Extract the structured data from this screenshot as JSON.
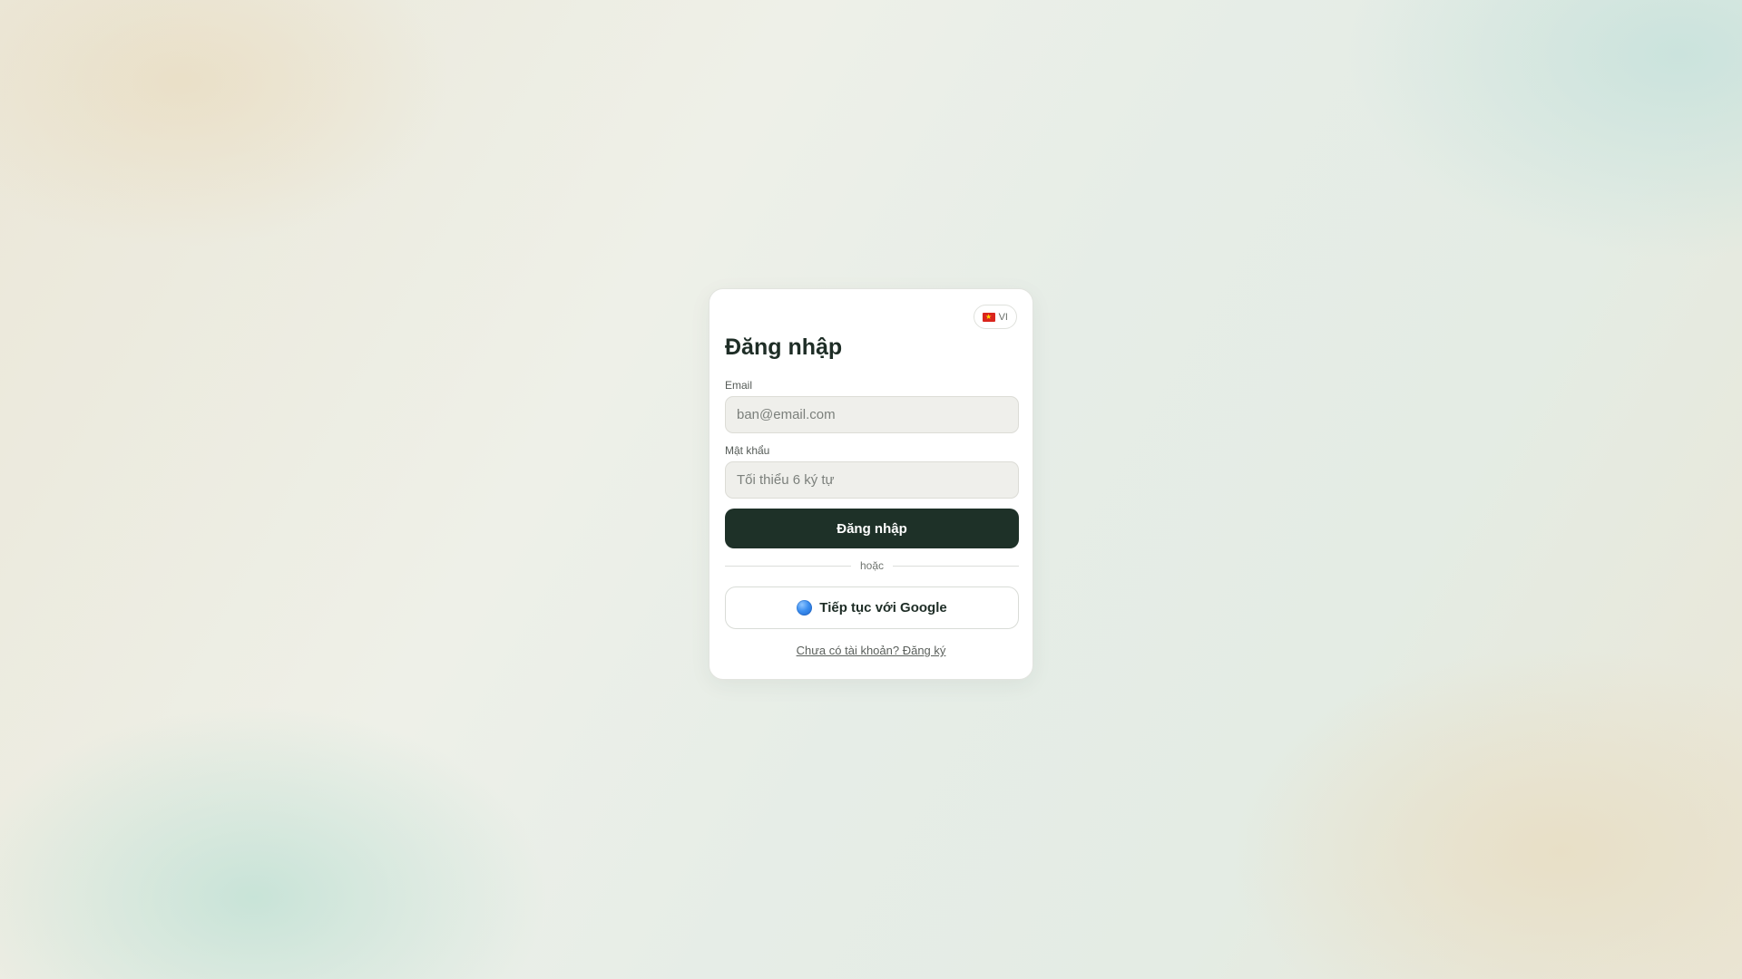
{
  "language_switcher": {
    "label": "VI",
    "flag_icon": "vietnam-flag-icon",
    "flag_glyph": "★"
  },
  "login": {
    "title": "Đăng nhập",
    "email_label": "Email",
    "email_placeholder": "ban@email.com",
    "email_value": "",
    "password_label": "Mật khẩu",
    "password_placeholder": "Tối thiểu 6 ký tự",
    "password_value": "",
    "submit_label": "Đăng nhập",
    "divider_text": "hoặc",
    "google_label": "Tiếp tục với Google",
    "google_icon": "google-icon",
    "signup_link": "Chưa có tài khoản? Đăng ký"
  },
  "colors": {
    "primary": "#1e3128",
    "text": "#1e2d26",
    "input_bg": "#efefeb"
  }
}
